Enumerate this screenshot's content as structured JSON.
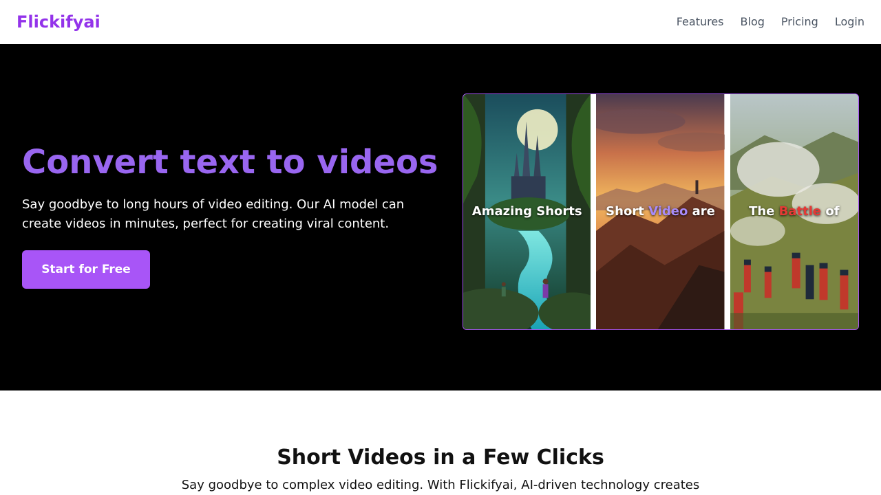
{
  "nav": {
    "brand": "Flickifyai",
    "links": [
      "Features",
      "Blog",
      "Pricing",
      "Login"
    ]
  },
  "hero": {
    "title": "Convert text to videos",
    "subtitle": "Say goodbye to long hours of video editing. Our AI model can create videos in minutes, perfect for creating viral content.",
    "cta": "Start for Free"
  },
  "showcase": {
    "panels": [
      {
        "caption_parts": [
          "Amazing Shorts",
          "",
          ""
        ]
      },
      {
        "caption_parts": [
          "Short ",
          "Video",
          " are"
        ]
      },
      {
        "caption_parts": [
          "The ",
          "Battle",
          " of"
        ]
      }
    ]
  },
  "features": {
    "title": "Short Videos in a Few Clicks",
    "text": "Say goodbye to complex video editing. With Flickifyai, AI-driven technology creates"
  },
  "colors": {
    "brand": "#9333ea",
    "hero_title": "#9966f0",
    "cta": "#a855f7",
    "hero_background": "#000000",
    "highlight_purple": "#a78bfa",
    "highlight_red": "#e53935"
  }
}
